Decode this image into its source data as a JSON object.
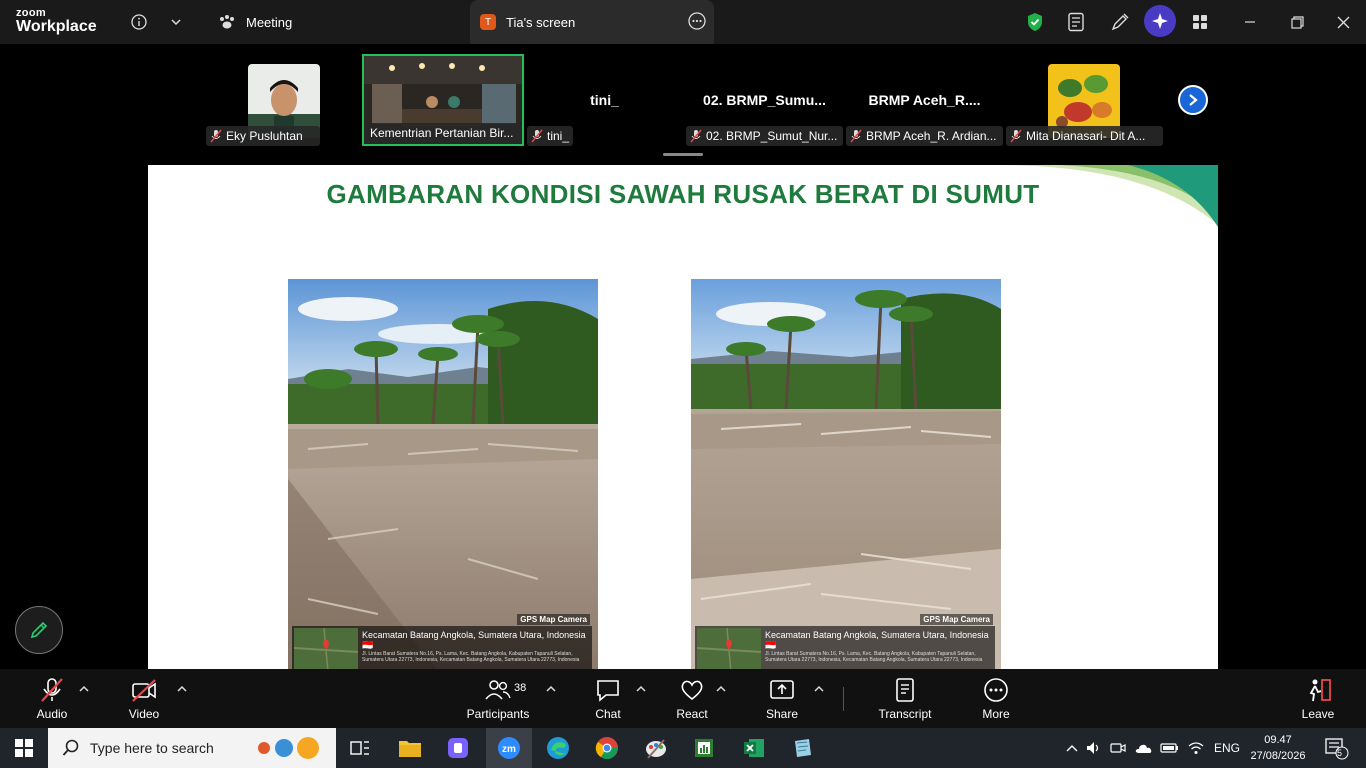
{
  "app": {
    "logo_top": "zoom",
    "logo_bottom": "Workplace"
  },
  "tabs": {
    "meeting": "Meeting",
    "screen": "Tia's screen",
    "screen_badge": "T"
  },
  "gallery": {
    "tiles": [
      {
        "name": "Eky Pusluhtan"
      },
      {
        "name": "Kementrian Pertanian Bir..."
      },
      {
        "name": "tini_",
        "big": "tini_"
      },
      {
        "name": "02. BRMP_Sumut_Nur...",
        "big": "02.  BRMP_Sumu..."
      },
      {
        "name": "BRMP Aceh_R. Ardian...",
        "big": "BRMP  Aceh_R...."
      },
      {
        "name": "Mita Dianasari- Dit A..."
      }
    ]
  },
  "slide": {
    "title": "GAMBARAN KONDISI SAWAH RUSAK BERAT DI SUMUT",
    "photos": [
      {
        "gps_label": "GPS Map Camera",
        "location": "Kecamatan Batang Angkola, Sumatera Utara, Indonesia 🇮🇩",
        "address": "Jl. Lintas Barat Sumatera No.16, Ps. Lama, Kec. Batang Angkola, Kabupaten Tapanuli Selatan, Sumatera Utara 22773, Indonesia, Kecamatan Batang Angkola, Sumatera Utara 22773, Indonesia"
      },
      {
        "gps_label": "GPS Map Camera",
        "location": "Kecamatan Batang Angkola, Sumatera Utara, Indonesia 🇮🇩",
        "address": "Jl. Lintas Barat Sumatera No.16, Ps. Lama, Kec. Batang Angkola, Kabupaten Tapanuli Selatan, Sumatera Utara 22773, Indonesia, Kecamatan Batang Angkola, Sumatera Utara 22773, Indonesia"
      }
    ]
  },
  "toolbar": {
    "audio": "Audio",
    "video": "Video",
    "participants": "Participants",
    "participants_count": "38",
    "chat": "Chat",
    "react": "React",
    "share": "Share",
    "transcript": "Transcript",
    "more": "More",
    "leave": "Leave"
  },
  "taskbar": {
    "search_placeholder": "Type here to search",
    "lang": "ENG",
    "time": "09.47",
    "date": "27/08/2026",
    "notifications": "5"
  },
  "colors": {
    "title_green": "#1f7a3e",
    "accent_blue": "#1a66d6",
    "mute_red": "#e5484d"
  }
}
